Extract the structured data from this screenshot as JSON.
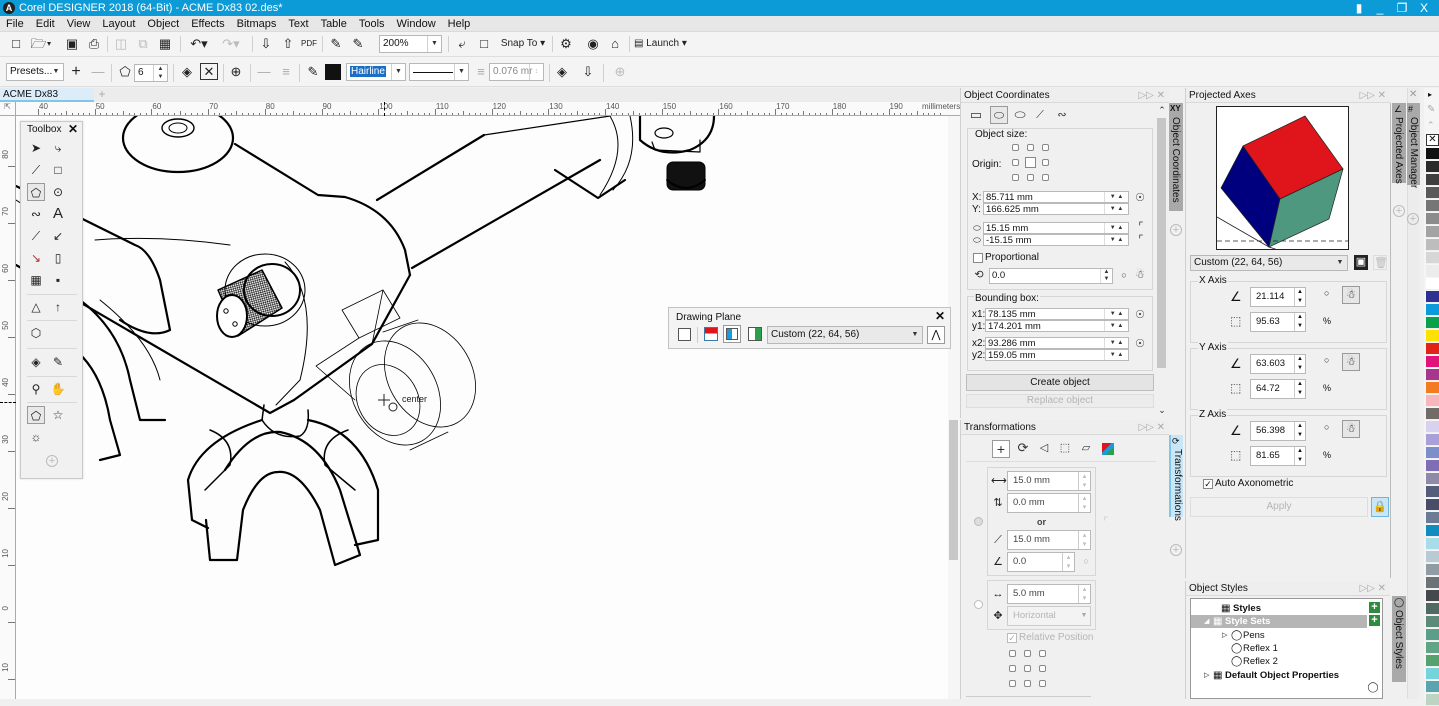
{
  "window": {
    "title": "Corel DESIGNER 2018 (64-Bit) - ACME Dx83 02.des*",
    "controls": {
      "profile": "user-icon",
      "minimize": "_",
      "restore": "❐",
      "close": "X"
    }
  },
  "menu": [
    "File",
    "Edit",
    "View",
    "Layout",
    "Object",
    "Effects",
    "Bitmaps",
    "Text",
    "Table",
    "Tools",
    "Window",
    "Help"
  ],
  "toolbar1": {
    "zoom_level": "200%",
    "snap_to_label": "Snap To",
    "launch_label": "Launch"
  },
  "toolbar2": {
    "presets_label": "Presets...",
    "sides_value": "6",
    "outline_width": "Hairline",
    "line_offset_value": "0.076 mr"
  },
  "document_tab": {
    "name": "ACME Dx83 02.des*"
  },
  "ruler": {
    "units": "millimeters",
    "h_ticks": [
      "40",
      "50",
      "60",
      "70",
      "80",
      "90",
      "100",
      "110",
      "120",
      "130",
      "140",
      "150",
      "160",
      "170",
      "180",
      "190"
    ],
    "v_ticks": [
      "80",
      "70",
      "60",
      "50",
      "40",
      "30",
      "20",
      "10",
      "0",
      "10"
    ]
  },
  "canvas": {
    "snap_label": "center"
  },
  "toolbox": {
    "title": "Toolbox",
    "close": "✕"
  },
  "drawing_plane": {
    "title": "Drawing Plane",
    "close": "✕",
    "preset_value": "Custom (22, 64, 56)"
  },
  "object_coordinates": {
    "title": "Object Coordinates",
    "tab_label": "Object Coordinates",
    "object_size_label": "Object size:",
    "origin_label": "Origin:",
    "x_label": "X:",
    "x_value": "85.711 mm",
    "y_label": "Y:",
    "y_value": "166.625 mm",
    "width_value": "15.15 mm",
    "height_value": "-15.15 mm",
    "proportional_label": "Proportional",
    "proportional_checked": false,
    "rotation_value": "0.0",
    "bounding_box_label": "Bounding box:",
    "x1_label": "x1:",
    "x1_value": "78.135 mm",
    "y1_label": "y1:",
    "y1_value": "174.201 mm",
    "x2_label": "x2:",
    "x2_value": "93.286 mm",
    "y2_label": "y2:",
    "y2_value": "159.05 mm",
    "create_button": "Create object",
    "replace_button": "Replace object"
  },
  "transformations": {
    "title": "Transformations",
    "tab_label": "Transformations",
    "h_value": "15.0 mm",
    "v_value": "0.0 mm",
    "or_label": "or",
    "distance_value": "15.0 mm",
    "angle_value": "0.0",
    "spacing_value": "5.0 mm",
    "direction_value": "Horizontal",
    "relative_position_label": "Relative Position",
    "relative_position_checked": true
  },
  "projected_axes": {
    "title": "Projected Axes",
    "tab_label": "Projected Axes",
    "preset_value": "Custom (22, 64, 56)",
    "x_axis": {
      "label": "X Axis",
      "angle": "21.114",
      "scale": "95.63",
      "unit": "%"
    },
    "y_axis": {
      "label": "Y Axis",
      "angle": "63.603",
      "scale": "64.72",
      "unit": "%"
    },
    "z_axis": {
      "label": "Z Axis",
      "angle": "56.398",
      "scale": "81.65",
      "unit": "%"
    },
    "auto_axonometric_label": "Auto Axonometric",
    "auto_axonometric_checked": true,
    "apply_button": "Apply",
    "cube_colors": {
      "top": "#e0141b",
      "left": "#00007f",
      "right": "#4f9880"
    }
  },
  "object_manager": {
    "tab_label": "Object Manager"
  },
  "object_styles": {
    "title": "Object Styles",
    "tab_label": "Object Styles",
    "tree": [
      {
        "label": "Styles",
        "level": 0,
        "bold": true,
        "selected": false
      },
      {
        "label": "Style Sets",
        "level": 0,
        "bold": true,
        "selected": true
      },
      {
        "label": "Pens",
        "level": 1,
        "bold": false,
        "selected": false
      },
      {
        "label": "Reflex 1",
        "level": 1,
        "bold": false,
        "selected": false
      },
      {
        "label": "Reflex 2",
        "level": 1,
        "bold": false,
        "selected": false
      },
      {
        "label": "Default Object Properties",
        "level": 0,
        "bold": true,
        "selected": false
      }
    ]
  },
  "palette": [
    "#111111",
    "#2b2b2b",
    "#3f3f3f",
    "#5a5a5a",
    "#767676",
    "#8c8c8c",
    "#a3a3a3",
    "#bdbdbd",
    "#d6d6d6",
    "#ececec",
    "#ffffff",
    "#2e3192",
    "#0d9ad8",
    "#0aa14b",
    "#fde100",
    "#e2231a",
    "#e2127a",
    "#a7378d",
    "#f47b20",
    "#f7b6bc",
    "#726c68",
    "#d8d2f0",
    "#a9a0d7",
    "#7b8fcb",
    "#7f6db5",
    "#8f8aa8",
    "#545d7a",
    "#4a4d68",
    "#6a7d94",
    "#0f8dc0",
    "#a7dceb",
    "#b8cbd4",
    "#909ba4",
    "#6a7478",
    "#45494b",
    "#4f6a62",
    "#5e8a7a",
    "#5d9e8b",
    "#60a587",
    "#56a26e",
    "#75d3dc",
    "#5aa3b0",
    "#bcd5c2"
  ]
}
